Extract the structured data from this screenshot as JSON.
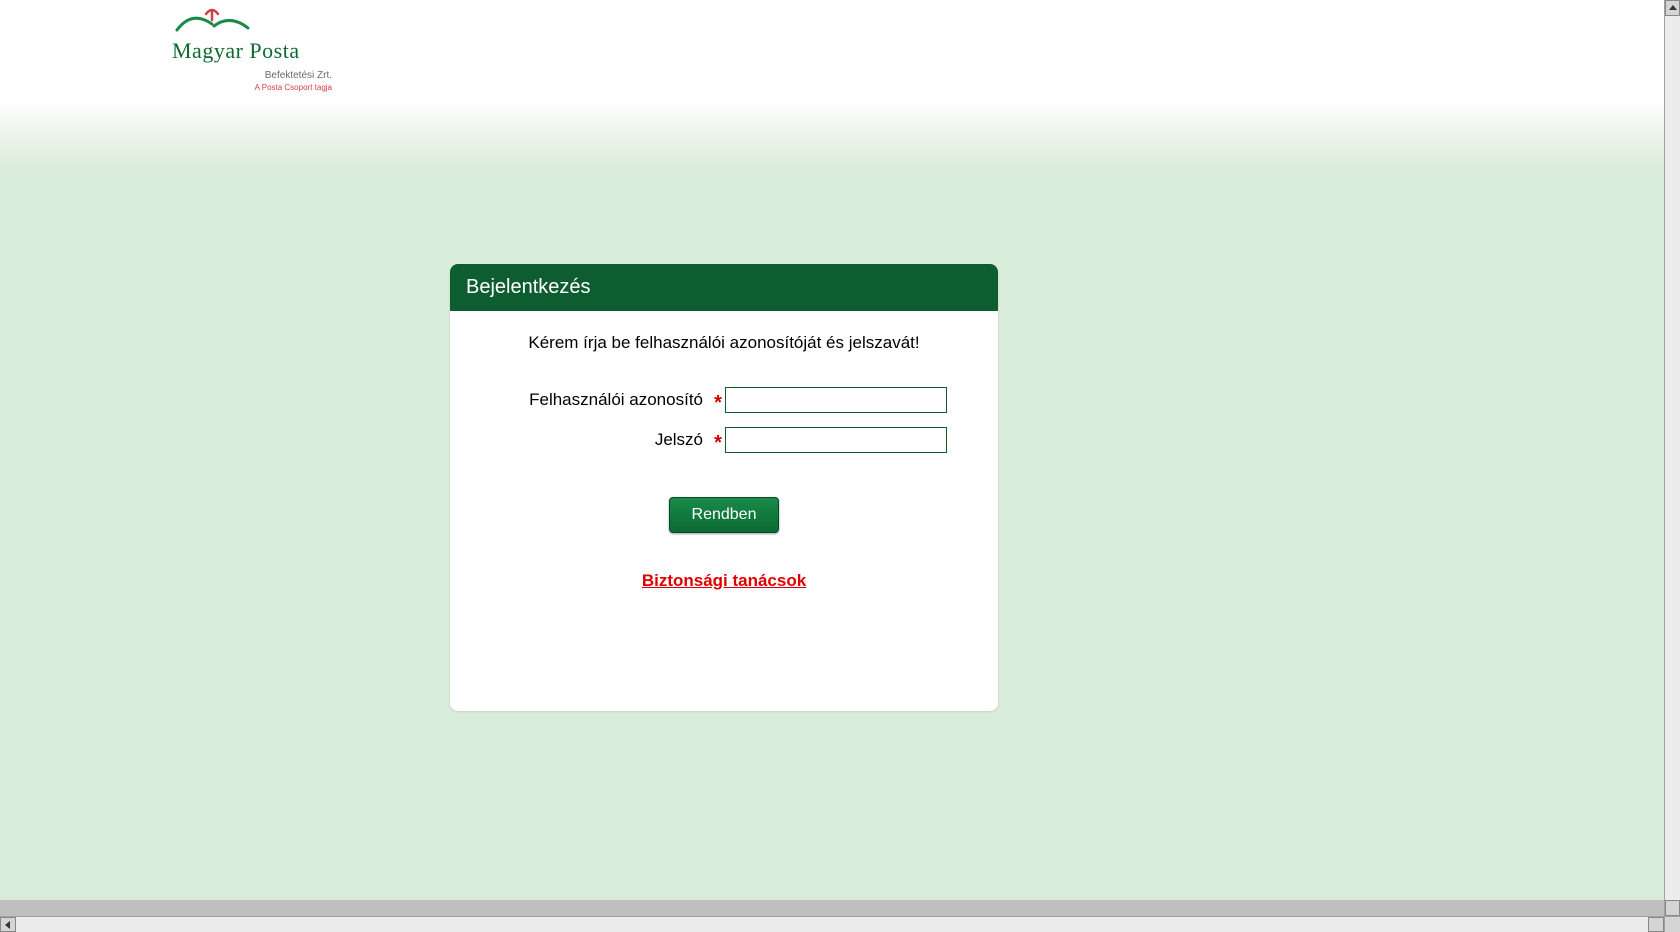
{
  "logo": {
    "name": "Magyar Posta",
    "subtitle1": "Befektetési Zrt.",
    "subtitle2": "A Posta Csoport tagja"
  },
  "login": {
    "panel_title": "Bejelentkezés",
    "instruction": "Kérem írja be felhasználói azonosítóját és jelszavát!",
    "username_label": "Felhasználói azonosító",
    "password_label": "Jelszó",
    "required_mark": "*",
    "username_value": "",
    "password_value": "",
    "submit_label": "Rendben",
    "security_link": "Biztonsági tanácsok"
  },
  "colors": {
    "brand_green": "#0e5d31",
    "bg_tint": "#d9ebd9",
    "link_red": "#e00000"
  }
}
